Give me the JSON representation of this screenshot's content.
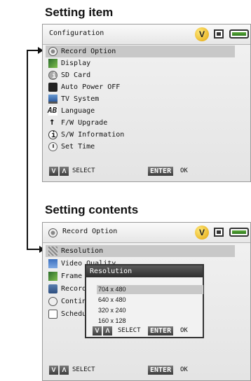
{
  "headings": {
    "top": "Setting item",
    "bottom": "Setting contents"
  },
  "top_panel": {
    "title": "Configuration",
    "status_icons": [
      "v-badge-icon",
      "hdd-icon",
      "battery-icon"
    ],
    "v_label": "V",
    "items": [
      {
        "label": "Record Option",
        "icon": "record-option-icon",
        "selected": true
      },
      {
        "label": "Display",
        "icon": "display-icon"
      },
      {
        "label": "SD Card",
        "icon": "sd-card-icon"
      },
      {
        "label": "Auto Power OFF",
        "icon": "auto-power-icon"
      },
      {
        "label": "TV System",
        "icon": "tv-icon"
      },
      {
        "label": "Language",
        "icon": "language-icon"
      },
      {
        "label": "F/W Upgrade",
        "icon": "upgrade-arrow-icon"
      },
      {
        "label": "S/W Information",
        "icon": "info-icon"
      },
      {
        "label": "Set Time",
        "icon": "clock-icon"
      }
    ],
    "footer": {
      "nav_keys": [
        "V",
        "Λ"
      ],
      "select_label": "SELECT",
      "enter_key": "ENTER",
      "ok_label": "OK"
    }
  },
  "bottom_panel": {
    "title": "Record Option",
    "v_label": "V",
    "items": [
      {
        "label": "Resolution",
        "icon": "resolution-icon",
        "selected": true
      },
      {
        "label": "Video Quality",
        "icon": "video-quality-icon"
      },
      {
        "label": "Frame",
        "icon": "frame-icon"
      },
      {
        "label": "Record",
        "icon": "record-mode-icon"
      },
      {
        "label": "Contin",
        "icon": "continuous-icon"
      },
      {
        "label": "Schedu",
        "icon": "schedule-icon"
      }
    ],
    "footer": {
      "nav_keys": [
        "V",
        "Λ"
      ],
      "select_label": "SELECT",
      "enter_key": "ENTER",
      "ok_label": "OK"
    }
  },
  "dialog": {
    "title": "Resolution",
    "options": [
      {
        "label": "704 x 480",
        "selected": true
      },
      {
        "label": "640 x 480"
      },
      {
        "label": "320 x 240"
      },
      {
        "label": "160 x 128"
      }
    ],
    "footer": {
      "nav_keys": [
        "V",
        "Λ"
      ],
      "select_label": "SELECT",
      "enter_key": "ENTER",
      "ok_label": "OK"
    }
  }
}
